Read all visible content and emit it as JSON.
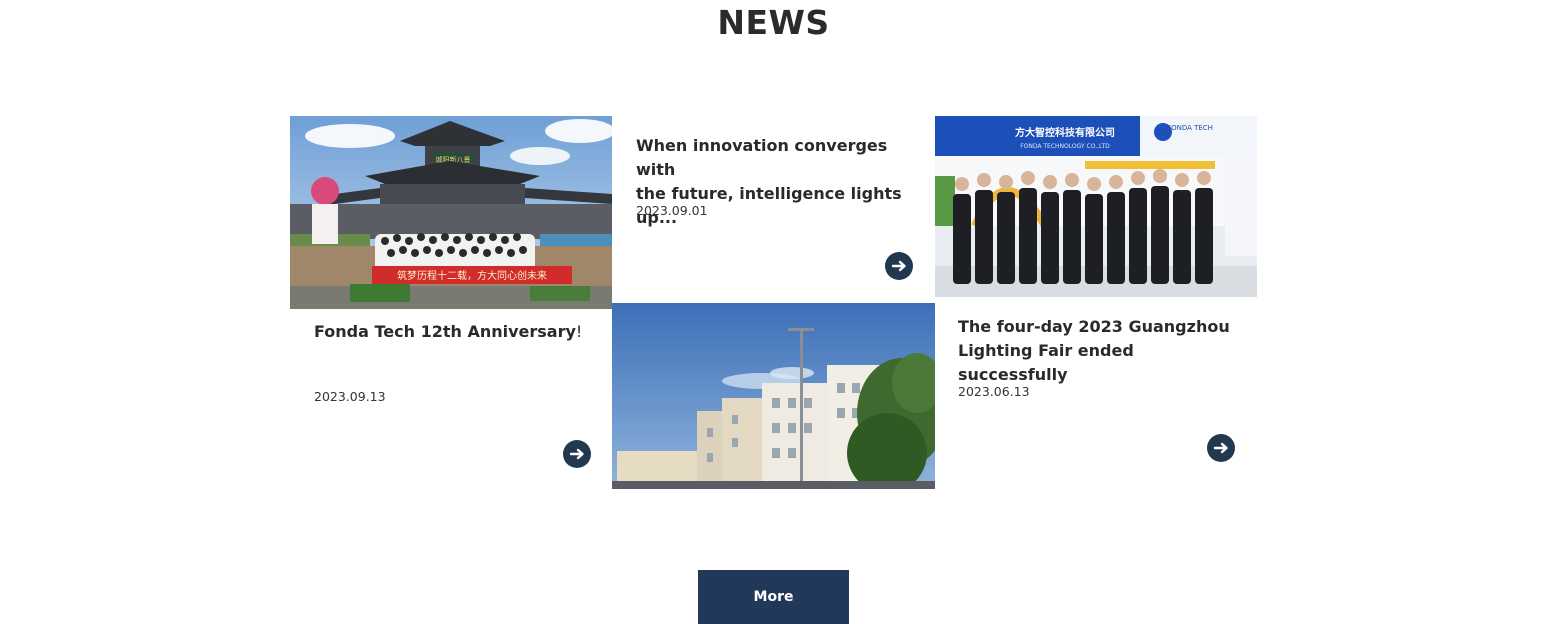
{
  "section": {
    "title": "NEWS"
  },
  "news": [
    {
      "headline": "Fonda Tech 12th Anniversary",
      "headline_mark": "!",
      "date": "2023.09.13",
      "photo_banner_text": "筑梦历程十二载，方大同心创未来",
      "photo_sign_text": "城阳新八景",
      "arrow_icon": "arrow-right-circle-icon"
    },
    {
      "headline_line1": "When innovation converges with",
      "headline_line2": "the future, intelligence lights up...",
      "date": "2023.09.01",
      "arrow_icon": "arrow-right-circle-icon"
    },
    {
      "headline_line1": "The four-day 2023 Guangzhou",
      "headline_line2": "Lighting Fair ended successfully",
      "date": "2023.06.13",
      "photo_sign_text": "方大智控科技有限公司",
      "photo_sign_sub": "FONDA TECHNOLOGY CO.,LTD",
      "photo_logo_text": "FONDA TECH",
      "arrow_icon": "arrow-right-circle-icon"
    }
  ],
  "more_button": {
    "label": "More"
  },
  "colors": {
    "navy": "#22384f",
    "button": "#21385a",
    "text": "#2a2a2a"
  }
}
